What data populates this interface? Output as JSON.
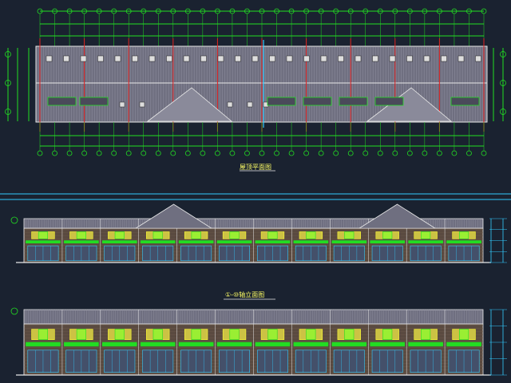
{
  "drawing": {
    "background": "#1a2230",
    "plan_caption": "屋顶平面图",
    "front_caption": "①-⑩轴立面图",
    "colors": {
      "green": "#22dd22",
      "red": "#e02020",
      "cyan": "#33ccff",
      "yellow": "#ffff33",
      "white": "#e8e8e8",
      "roof": "#6f6f80",
      "brick": "#5a4a40"
    }
  }
}
